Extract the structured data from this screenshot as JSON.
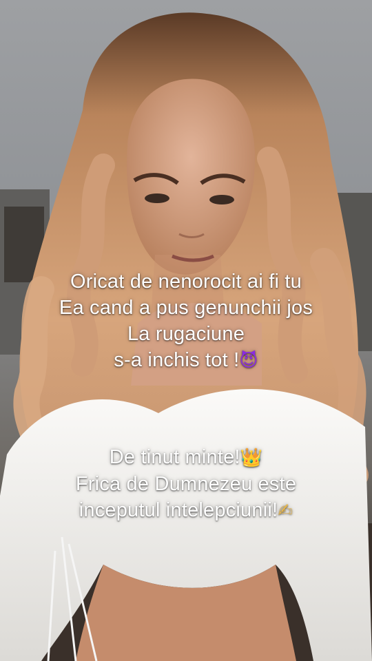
{
  "colors": {
    "background_gray": "#9ea0a3",
    "hair": "#c9936a",
    "shirt": "#f4f3f1",
    "skin": "#d9a88b",
    "text": "#ffffff"
  },
  "caption": {
    "block1": {
      "line1": "Oricat de nenorocit ai fi tu",
      "line2": "Ea cand a pus genunchii jos",
      "line3": "La rugaciune",
      "line4": "s-a inchis tot !",
      "line4_emoji": "😈"
    },
    "block2": {
      "line1": "De tinut minte!",
      "line1_emoji": "👑",
      "line2": "Frica de Dumnezeu este",
      "line3": "inceputul intelepciunii!",
      "line3_emoji": "✍"
    }
  }
}
